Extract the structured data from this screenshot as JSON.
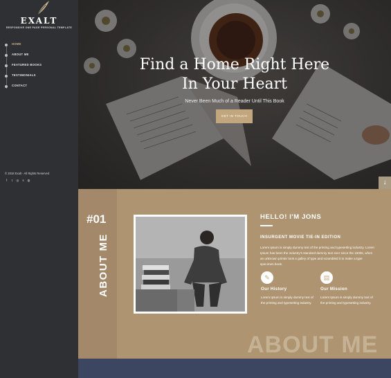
{
  "brand": {
    "name": "EXALT",
    "tagline": "RESPONSIVE ONE PAGE PERSONAL TEMPLATE",
    "logo_icon": "feather-icon"
  },
  "nav": {
    "items": [
      {
        "label": "HOME",
        "active": true
      },
      {
        "label": "ABOUT ME",
        "active": false
      },
      {
        "label": "FEATURED BOOKS",
        "active": false
      },
      {
        "label": "TESTIMONIALS",
        "active": false
      },
      {
        "label": "CONTACT",
        "active": false
      }
    ]
  },
  "footer": {
    "copyright": "© 2018 Exalt - All Rights Reserved",
    "socials": [
      {
        "icon": "facebook-icon",
        "glyph": "f"
      },
      {
        "icon": "twitter-icon",
        "glyph": "t"
      },
      {
        "icon": "instagram-icon",
        "glyph": "◎"
      },
      {
        "icon": "skype-icon",
        "glyph": "s"
      },
      {
        "icon": "dribbble-icon",
        "glyph": "◍"
      }
    ]
  },
  "hero": {
    "title_line1": "Find a Home Right Here",
    "title_line2": "In Your Heart",
    "subtitle": "Never Been Much of a Reader Until This Book",
    "button_label": "GET IN TOUCH",
    "scroll_icon": "arrow-down-icon"
  },
  "about": {
    "number": "#01",
    "vertical_title": "ABOUT ME",
    "heading": "HELLO! I'M JONS",
    "edition": "INSURGENT MOVIE TIE-IN EDITION",
    "paragraph": "Lorem Ipsum is simply dummy text of the printing and typesetting industry. Lorem Ipsum has been the industry's standard dummy text ever since the 1500s, when an unknown printer took a galley of type and scrambled it to make a type specimen book.",
    "features": [
      {
        "title": "Our History",
        "text": "Lorem Ipsum is simply dummy text of the printing and typesetting industry.",
        "icon": "history-book-icon"
      },
      {
        "title": "Our Mission",
        "text": "Lorem Ipsum is simply dummy text of the printing and typesetting industry.",
        "icon": "mission-book-icon"
      }
    ],
    "watermark": "ABOUT ME"
  },
  "colors": {
    "sidebar": "#2f3033",
    "accent": "#c2a67e",
    "about_bg": "#ae9470",
    "bottom_strip": "#3d4660"
  }
}
